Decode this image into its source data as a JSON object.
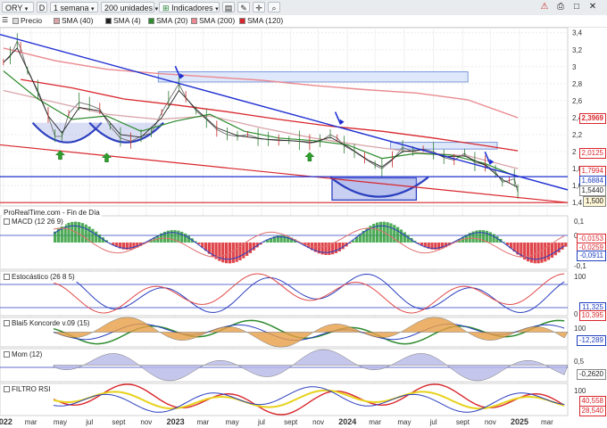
{
  "toolbar": {
    "symbol": "ORY",
    "mode": "D",
    "period": "1 semana",
    "units": "200 unidades",
    "indicators": "Indicadores"
  },
  "legend": [
    {
      "label": "Precio",
      "color": "#d9d9d9"
    },
    {
      "label": "SMA (40)",
      "color": "#d8a4a8"
    },
    {
      "label": "SMA (4)",
      "color": "#222222"
    },
    {
      "label": "SMA (20)",
      "color": "#2e8b2e"
    },
    {
      "label": "SMA (200)",
      "color": "#ea8a90"
    },
    {
      "label": "SMA (120)",
      "color": "#d9262c"
    }
  ],
  "source_label": "ProRealTime.com - Fin de Día",
  "panels": {
    "macd": {
      "title": "MACD (12 26 9)",
      "ticks": [
        "0,1",
        "0",
        "-0,1"
      ],
      "tags": [
        "-0,0153",
        "-0,0259",
        "-0,0911"
      ]
    },
    "stoch": {
      "title": "Estocástico (26 8 5)",
      "ticks": [
        "100",
        "0"
      ],
      "tags": [
        "11,325",
        "10,395"
      ]
    },
    "konc": {
      "title": "Blai5 Koncorde v.09 (15)",
      "ticks": [
        "100"
      ],
      "tags": [
        "-12,289"
      ]
    },
    "mom": {
      "title": "Mom (12)",
      "ticks": [
        "0,5"
      ],
      "tags": [
        "-0,2620"
      ]
    },
    "rsi": {
      "title": "FILTRO RSI",
      "ticks": [
        "100"
      ],
      "tags": [
        "40,558",
        "28,540"
      ]
    }
  },
  "chart_data": {
    "type": "line",
    "symbol": "ORY",
    "timeframe": "1 semana",
    "price_axis": [
      "3,4",
      "3,2",
      "3",
      "2,8",
      "2,6",
      "2,4",
      "2,2",
      "2",
      "1,8",
      "1,6",
      "1,4"
    ],
    "ylim": [
      1.36,
      3.46
    ],
    "x_labels": [
      "2022",
      "mar",
      "may",
      "jul",
      "sept",
      "nov",
      "2023",
      "mar",
      "may",
      "jul",
      "sept",
      "nov",
      "2024",
      "mar",
      "may",
      "jul",
      "sept",
      "nov",
      "2025",
      "mar"
    ],
    "price_tags": [
      {
        "value": "2,3969",
        "color": "red"
      },
      {
        "value": "2,0125",
        "color": "red"
      },
      {
        "value": "1,7994",
        "color": "red"
      },
      {
        "value": "1,6884",
        "color": "blue"
      },
      {
        "value": "1,5440",
        "color": "black"
      },
      {
        "value": "1,500",
        "color": "black"
      }
    ],
    "series": [
      {
        "name": "Precio",
        "points": [
          [
            2022.0,
            3.05
          ],
          [
            2022.04,
            3.12
          ],
          [
            2022.08,
            3.3
          ],
          [
            2022.1,
            3.22
          ],
          [
            2022.14,
            2.95
          ],
          [
            2022.2,
            2.72
          ],
          [
            2022.26,
            2.42
          ],
          [
            2022.3,
            2.18
          ],
          [
            2022.34,
            2.18
          ],
          [
            2022.38,
            2.45
          ],
          [
            2022.44,
            2.58
          ],
          [
            2022.5,
            2.55
          ],
          [
            2022.56,
            2.5
          ],
          [
            2022.62,
            2.3
          ],
          [
            2022.68,
            2.16
          ],
          [
            2022.74,
            2.12
          ],
          [
            2022.8,
            2.18
          ],
          [
            2022.86,
            2.22
          ],
          [
            2022.92,
            2.46
          ],
          [
            2022.96,
            2.6
          ],
          [
            2023.02,
            2.8
          ],
          [
            2023.06,
            2.64
          ],
          [
            2023.12,
            2.48
          ],
          [
            2023.18,
            2.38
          ],
          [
            2023.24,
            2.26
          ],
          [
            2023.3,
            2.2
          ],
          [
            2023.36,
            2.18
          ],
          [
            2023.42,
            2.2
          ],
          [
            2023.48,
            2.16
          ],
          [
            2023.54,
            2.14
          ],
          [
            2023.6,
            2.13
          ],
          [
            2023.66,
            2.13
          ],
          [
            2023.72,
            2.12
          ],
          [
            2023.78,
            2.1
          ],
          [
            2023.84,
            2.12
          ],
          [
            2023.9,
            2.2
          ],
          [
            2023.94,
            2.16
          ],
          [
            2023.98,
            2.07
          ],
          [
            2024.04,
            2.0
          ],
          [
            2024.1,
            1.92
          ],
          [
            2024.16,
            1.84
          ],
          [
            2024.2,
            1.8
          ],
          [
            2024.26,
            1.9
          ],
          [
            2024.32,
            2.05
          ],
          [
            2024.38,
            2.0
          ],
          [
            2024.44,
            2.03
          ],
          [
            2024.5,
            2.0
          ],
          [
            2024.56,
            1.93
          ],
          [
            2024.62,
            1.9
          ],
          [
            2024.68,
            1.98
          ],
          [
            2024.74,
            1.87
          ],
          [
            2024.8,
            1.85
          ],
          [
            2024.86,
            1.76
          ],
          [
            2024.9,
            1.64
          ],
          [
            2024.94,
            1.66
          ],
          [
            2024.97,
            1.68
          ],
          [
            2024.99,
            1.52
          ]
        ]
      },
      {
        "name": "SMA (200)",
        "points": [
          [
            2022.0,
            3.22
          ],
          [
            2022.3,
            3.07
          ],
          [
            2022.6,
            2.97
          ],
          [
            2022.9,
            2.92
          ],
          [
            2023.2,
            2.88
          ],
          [
            2023.5,
            2.84
          ],
          [
            2023.8,
            2.78
          ],
          [
            2024.1,
            2.73
          ],
          [
            2024.4,
            2.69
          ],
          [
            2024.7,
            2.61
          ],
          [
            2024.99,
            2.4
          ]
        ]
      },
      {
        "name": "SMA (120)",
        "points": [
          [
            2022.1,
            2.85
          ],
          [
            2022.4,
            2.75
          ],
          [
            2022.7,
            2.62
          ],
          [
            2023.0,
            2.55
          ],
          [
            2023.3,
            2.47
          ],
          [
            2023.6,
            2.38
          ],
          [
            2023.9,
            2.3
          ],
          [
            2024.2,
            2.24
          ],
          [
            2024.5,
            2.16
          ],
          [
            2024.8,
            2.07
          ],
          [
            2024.99,
            2.01
          ]
        ]
      },
      {
        "name": "SMA (40)",
        "points": [
          [
            2022.0,
            2.72
          ],
          [
            2022.3,
            2.58
          ],
          [
            2022.6,
            2.44
          ],
          [
            2022.9,
            2.38
          ],
          [
            2023.2,
            2.42
          ],
          [
            2023.5,
            2.28
          ],
          [
            2023.8,
            2.16
          ],
          [
            2024.1,
            2.07
          ],
          [
            2024.4,
            1.99
          ],
          [
            2024.7,
            1.95
          ],
          [
            2024.99,
            1.8
          ]
        ]
      },
      {
        "name": "SMA (20)",
        "points": [
          [
            2022.0,
            2.95
          ],
          [
            2022.2,
            2.62
          ],
          [
            2022.4,
            2.38
          ],
          [
            2022.6,
            2.42
          ],
          [
            2022.8,
            2.24
          ],
          [
            2023.0,
            2.36
          ],
          [
            2023.2,
            2.44
          ],
          [
            2023.4,
            2.24
          ],
          [
            2023.6,
            2.16
          ],
          [
            2023.8,
            2.13
          ],
          [
            2024.0,
            2.08
          ],
          [
            2024.2,
            1.92
          ],
          [
            2024.4,
            1.98
          ],
          [
            2024.6,
            1.96
          ],
          [
            2024.8,
            1.86
          ],
          [
            2024.99,
            1.7
          ]
        ]
      },
      {
        "name": "SMA (4)",
        "points": [
          [
            2022.0,
            3.05
          ],
          [
            2022.08,
            3.22
          ],
          [
            2022.16,
            2.88
          ],
          [
            2022.26,
            2.42
          ],
          [
            2022.34,
            2.22
          ],
          [
            2022.44,
            2.52
          ],
          [
            2022.56,
            2.48
          ],
          [
            2022.68,
            2.2
          ],
          [
            2022.8,
            2.17
          ],
          [
            2022.92,
            2.4
          ],
          [
            2023.02,
            2.72
          ],
          [
            2023.12,
            2.5
          ],
          [
            2023.24,
            2.28
          ],
          [
            2023.36,
            2.19
          ],
          [
            2023.5,
            2.15
          ],
          [
            2023.66,
            2.13
          ],
          [
            2023.8,
            2.11
          ],
          [
            2023.9,
            2.17
          ],
          [
            2024.0,
            2.06
          ],
          [
            2024.12,
            1.9
          ],
          [
            2024.2,
            1.82
          ],
          [
            2024.32,
            2.0
          ],
          [
            2024.44,
            2.02
          ],
          [
            2024.56,
            1.94
          ],
          [
            2024.68,
            1.95
          ],
          [
            2024.8,
            1.84
          ],
          [
            2024.9,
            1.67
          ],
          [
            2024.99,
            1.58
          ]
        ]
      }
    ],
    "annotations": {
      "blue_trendline": [
        [
          2021.98,
          3.38
        ],
        [
          2025.28,
          1.55
        ]
      ],
      "red_trendline": [
        [
          2021.98,
          2.08
        ],
        [
          2025.28,
          1.4
        ]
      ],
      "blue_horizontal": 1.705,
      "red_horizontal": 1.4,
      "resistance_box": {
        "x": [
          2022.9,
          2024.7
        ],
        "y": [
          2.82,
          2.94
        ]
      },
      "shaded_box": {
        "x": [
          2023.91,
          2024.4
        ],
        "y": [
          1.43,
          1.69
        ]
      },
      "small_box": {
        "x": [
          2024.25,
          2024.87
        ],
        "y": [
          2.03,
          2.11
        ]
      },
      "arrows_down": [
        [
          2023.03,
          2.86
        ],
        [
          2023.96,
          2.32
        ],
        [
          2024.83,
          1.85
        ]
      ],
      "arrows_up": [
        [
          2022.33,
          1.95
        ],
        [
          2022.6,
          1.92
        ],
        [
          2023.78,
          1.93
        ]
      ],
      "bowls": [
        [
          2022.17,
          2.34,
          2022.57
        ],
        [
          2022.5,
          2.34,
          2022.93
        ],
        [
          2023.9,
          1.7,
          2024.47
        ]
      ]
    }
  }
}
